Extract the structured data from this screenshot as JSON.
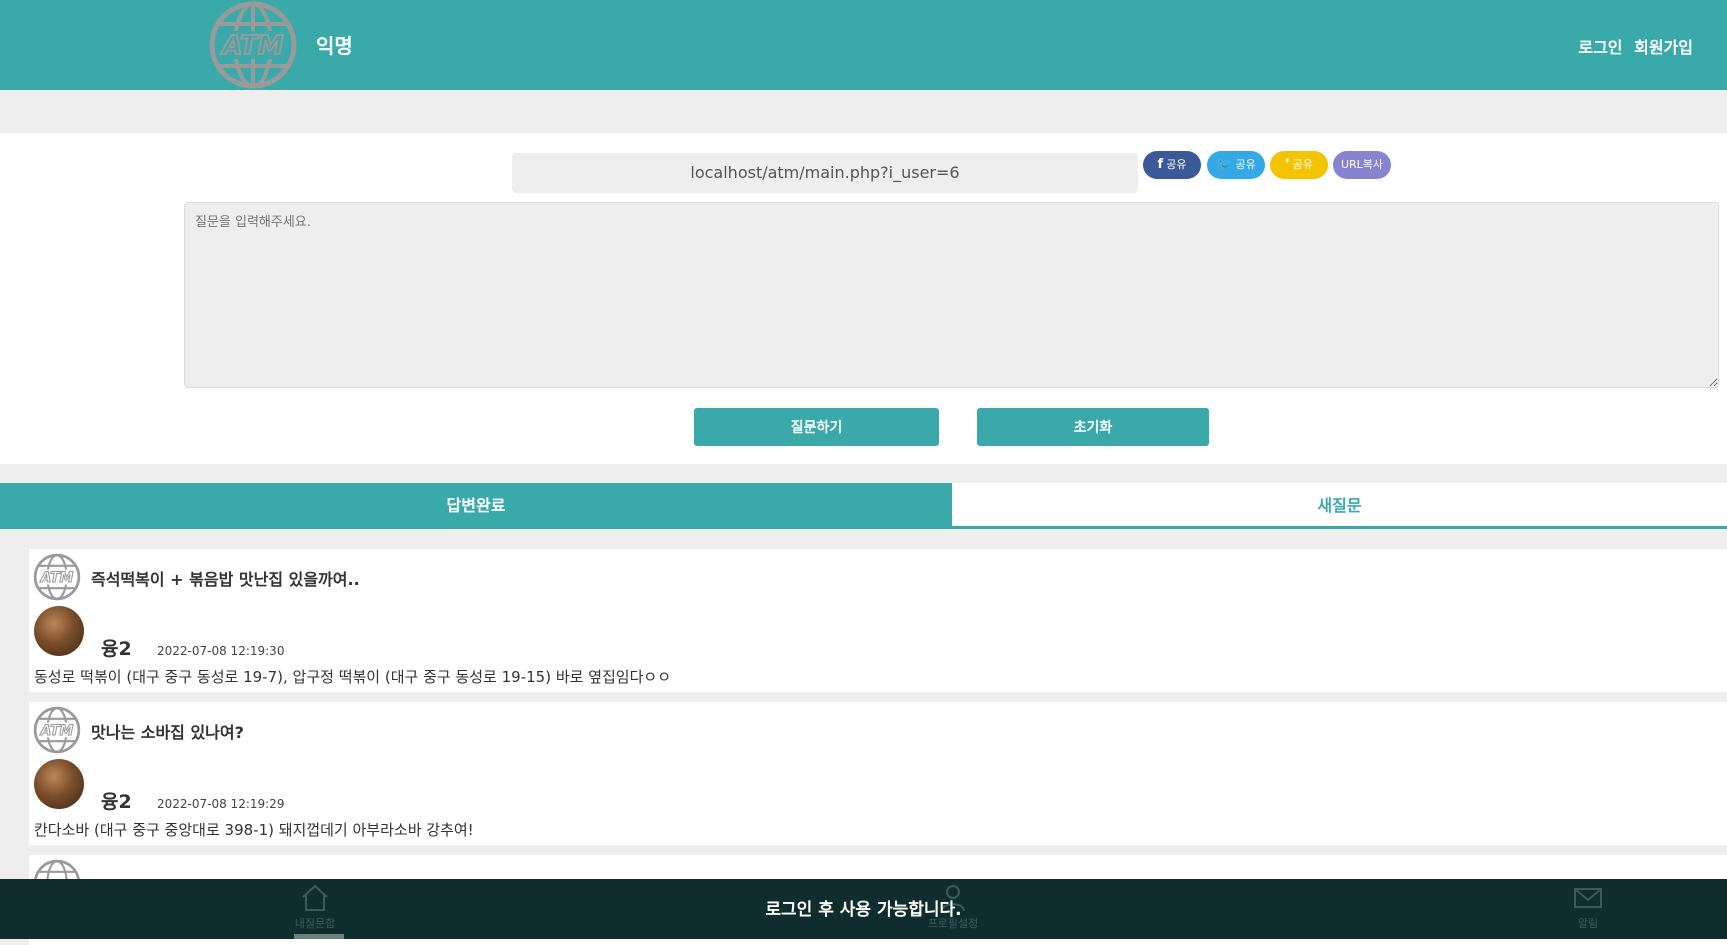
{
  "header": {
    "logo_text": "ATM",
    "site_title": "익명",
    "login_label": "로그인",
    "signup_label": "회원가입"
  },
  "ask": {
    "share_url": "localhost/atm/main.php?i_user=6",
    "share_buttons": [
      {
        "icon": "facebook-icon",
        "icon_glyph": "f",
        "label": "공유",
        "color": "#3b5998"
      },
      {
        "icon": "twitter-icon",
        "icon_glyph": "🐦",
        "label": "공유",
        "color": "#35a8e8"
      },
      {
        "icon": "kakaostory-icon",
        "icon_glyph": "❜",
        "label": "공유",
        "color": "#f5c400"
      },
      {
        "label": "URL복사",
        "color": "#8883d0"
      }
    ],
    "question_placeholder": "질문을 입력해주세요.",
    "submit_label": "질문하기",
    "reset_label": "초기화"
  },
  "tabs": {
    "answered_label": "답변완료",
    "new_label": "새질문"
  },
  "questions": [
    {
      "question": "즉석떡복이 + 볶음밥 맛난집 있을까여..",
      "user": "융2",
      "time": "2022-07-08 12:19:30",
      "answer": "동성로 떡볶이 (대구 중구 동성로 19-7), 압구정 떡볶이 (대구 중구 동성로 19-15) 바로 옆집임다ㅇㅇ"
    },
    {
      "question": "맛나는 소바집 있나여?",
      "user": "융2",
      "time": "2022-07-08 12:19:29",
      "answer": "칸다소바 (대구 중구 중앙대로 398-1) 돼지껍데기 아부라소바 강추여!"
    }
  ],
  "bottom_nav": {
    "home_label": "내질문함",
    "profile_label": "프로필설정",
    "alarm_label": "알림",
    "login_notice": "로그인 후 사용 가능합니다."
  },
  "colors": {
    "accent": "#3aa9aa",
    "background": "#eeeeee",
    "bottom_bar": "#0f2d2d"
  }
}
